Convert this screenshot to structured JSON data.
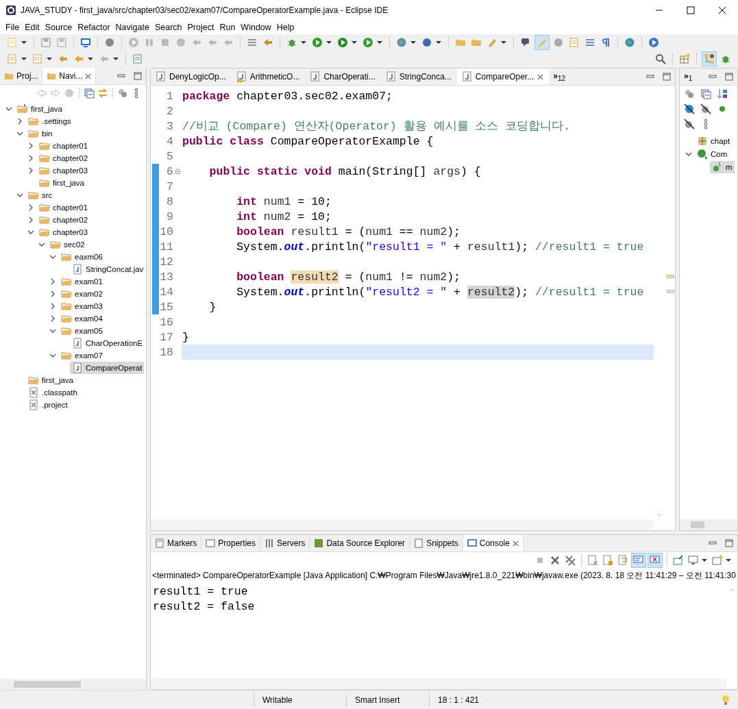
{
  "window": {
    "title": "JAVA_STUDY - first_java/src/chapter03/sec02/exam07/CompareOperatorExample.java - Eclipse IDE"
  },
  "menu": [
    "File",
    "Edit",
    "Source",
    "Refactor",
    "Navigate",
    "Search",
    "Project",
    "Run",
    "Window",
    "Help"
  ],
  "toolbar": {
    "mark_occurrences_on": true,
    "java_perspective_selected": true
  },
  "navigator": {
    "tabs": [
      {
        "label": "Proj...",
        "selected": false
      },
      {
        "label": "Navi...",
        "selected": true
      }
    ],
    "tree": [
      {
        "label": "first_java",
        "kind": "project",
        "expanded": true,
        "selected": false,
        "children": [
          {
            "label": ".settings",
            "kind": "folder",
            "expanded": false,
            "selected": false
          },
          {
            "label": "bin",
            "kind": "folder",
            "expanded": true,
            "selected": false,
            "children": [
              {
                "label": "chapter01",
                "kind": "folder",
                "expanded": false,
                "selected": false
              },
              {
                "label": "chapter02",
                "kind": "folder",
                "expanded": false,
                "selected": false
              },
              {
                "label": "chapter03",
                "kind": "folder",
                "expanded": false,
                "selected": false
              },
              {
                "label": "first_java",
                "kind": "folder",
                "selected": false
              }
            ]
          },
          {
            "label": "src",
            "kind": "folder",
            "expanded": true,
            "selected": false,
            "children": [
              {
                "label": "chapter01",
                "kind": "folder",
                "expanded": false,
                "selected": false
              },
              {
                "label": "chapter02",
                "kind": "folder",
                "expanded": false,
                "selected": false
              },
              {
                "label": "chapter03",
                "kind": "folder",
                "expanded": true,
                "selected": false,
                "children": [
                  {
                    "label": "sec02",
                    "kind": "folder",
                    "expanded": true,
                    "selected": false,
                    "children": [
                      {
                        "label": "eaxm06",
                        "kind": "folder",
                        "expanded": true,
                        "selected": false,
                        "children": [
                          {
                            "label": "StringConcat.jav",
                            "kind": "java-file",
                            "selected": false
                          }
                        ]
                      },
                      {
                        "label": "exam01",
                        "kind": "folder",
                        "expanded": false,
                        "selected": false
                      },
                      {
                        "label": "exam02",
                        "kind": "folder",
                        "expanded": false,
                        "selected": false
                      },
                      {
                        "label": "exam03",
                        "kind": "folder",
                        "expanded": false,
                        "selected": false
                      },
                      {
                        "label": "exam04",
                        "kind": "folder",
                        "expanded": false,
                        "selected": false
                      },
                      {
                        "label": "exam05",
                        "kind": "folder",
                        "expanded": true,
                        "selected": false,
                        "children": [
                          {
                            "label": "CharOperationE",
                            "kind": "java-file",
                            "selected": false
                          }
                        ]
                      },
                      {
                        "label": "exam07",
                        "kind": "folder",
                        "expanded": true,
                        "selected": false,
                        "children": [
                          {
                            "label": "CompareOperat",
                            "kind": "java-file",
                            "selected": true
                          }
                        ]
                      }
                    ]
                  }
                ]
              }
            ]
          },
          {
            "label": "first_java",
            "kind": "folder",
            "selected": false
          },
          {
            "label": ".classpath",
            "kind": "xml-file",
            "selected": false
          },
          {
            "label": ".project",
            "kind": "xml-file",
            "selected": false
          }
        ]
      }
    ]
  },
  "editor": {
    "tabs": [
      {
        "label": "DenyLogicOp...",
        "warning": false,
        "selected": false
      },
      {
        "label": "ArithmeticO...",
        "warning": true,
        "selected": false
      },
      {
        "label": "CharOperati...",
        "warning": false,
        "selected": false
      },
      {
        "label": "StringConca...",
        "warning": false,
        "selected": false
      },
      {
        "label": "CompareOper...",
        "warning": false,
        "selected": true
      }
    ],
    "overflow": {
      "symbol": "»",
      "count": "12"
    },
    "lines": [
      {
        "number": "1",
        "changed": false,
        "current": false,
        "segments": [
          {
            "text": "package",
            "kind": "keyword"
          },
          {
            "text": " chapter03.sec02.exam07;",
            "kind": "plain"
          }
        ]
      },
      {
        "number": "2",
        "changed": false,
        "current": false
      },
      {
        "number": "3",
        "changed": false,
        "current": false,
        "segments": [
          {
            "text": "//비교 (Compare) 연산자(Operator) 활용 예시를 소스 코딩합니다.",
            "kind": "comment"
          }
        ]
      },
      {
        "number": "4",
        "changed": false,
        "current": false,
        "segments": [
          {
            "text": "public class",
            "kind": "keyword"
          },
          {
            "text": " CompareOperatorExample {",
            "kind": "plain"
          }
        ]
      },
      {
        "number": "5",
        "changed": false,
        "current": false
      },
      {
        "number": "6",
        "changed": true,
        "current": false,
        "folded": false,
        "segments": [
          {
            "text": "    public static void",
            "kind": "keyword"
          },
          {
            "text": " main(String[] ",
            "kind": "plain"
          },
          {
            "text": "args",
            "kind": "variable"
          },
          {
            "text": ") {",
            "kind": "plain"
          }
        ]
      },
      {
        "number": "7",
        "changed": true,
        "current": false
      },
      {
        "number": "8",
        "changed": true,
        "current": false,
        "segments": [
          {
            "text": "        int ",
            "kind": "keyword"
          },
          {
            "text": "num1",
            "kind": "variable"
          },
          {
            "text": " = 10;",
            "kind": "plain"
          }
        ]
      },
      {
        "number": "9",
        "changed": true,
        "current": false,
        "segments": [
          {
            "text": "        int ",
            "kind": "keyword"
          },
          {
            "text": "num2",
            "kind": "variable"
          },
          {
            "text": " = 10;",
            "kind": "plain"
          }
        ]
      },
      {
        "number": "10",
        "changed": true,
        "current": false,
        "segments": [
          {
            "text": "        boolean ",
            "kind": "keyword"
          },
          {
            "text": "result1",
            "kind": "variable"
          },
          {
            "text": " = (",
            "kind": "plain"
          },
          {
            "text": "num1",
            "kind": "variable"
          },
          {
            "text": " == ",
            "kind": "plain"
          },
          {
            "text": "num2",
            "kind": "variable"
          },
          {
            "text": ");",
            "kind": "plain"
          }
        ]
      },
      {
        "number": "11",
        "changed": true,
        "current": false,
        "segments": [
          {
            "text": "        System.",
            "kind": "plain"
          },
          {
            "text": "out",
            "kind": "static-field"
          },
          {
            "text": ".println(",
            "kind": "plain"
          },
          {
            "text": "\"result1 = \"",
            "kind": "string"
          },
          {
            "text": " + ",
            "kind": "plain"
          },
          {
            "text": "result1",
            "kind": "variable"
          },
          {
            "text": "); ",
            "kind": "plain"
          },
          {
            "text": "//result1 = true",
            "kind": "comment"
          }
        ]
      },
      {
        "number": "12",
        "changed": true,
        "current": false
      },
      {
        "number": "13",
        "changed": true,
        "current": false,
        "segments": [
          {
            "text": "        boolean ",
            "kind": "keyword"
          },
          {
            "text": "result2",
            "kind": "write-occurrence"
          },
          {
            "text": " = (",
            "kind": "plain"
          },
          {
            "text": "num1",
            "kind": "variable"
          },
          {
            "text": " != ",
            "kind": "plain"
          },
          {
            "text": "num2",
            "kind": "variable"
          },
          {
            "text": ");",
            "kind": "plain"
          }
        ]
      },
      {
        "number": "14",
        "changed": true,
        "current": false,
        "segments": [
          {
            "text": "        System.",
            "kind": "plain"
          },
          {
            "text": "out",
            "kind": "static-field"
          },
          {
            "text": ".println(",
            "kind": "plain"
          },
          {
            "text": "\"result2 = \"",
            "kind": "string"
          },
          {
            "text": " + ",
            "kind": "plain"
          },
          {
            "text": "result2",
            "kind": "read-occurrence"
          },
          {
            "text": "); ",
            "kind": "plain"
          },
          {
            "text": "//result1 = true",
            "kind": "comment"
          }
        ]
      },
      {
        "number": "15",
        "changed": true,
        "current": false,
        "segments": [
          {
            "text": "    }",
            "kind": "plain"
          }
        ]
      },
      {
        "number": "16",
        "changed": false,
        "current": false
      },
      {
        "number": "17",
        "changed": false,
        "current": false,
        "segments": [
          {
            "text": "}",
            "kind": "plain"
          }
        ]
      },
      {
        "number": "18",
        "changed": false,
        "current": true
      }
    ]
  },
  "outline": {
    "overflow": {
      "symbol": "»",
      "count": "1"
    },
    "items": [
      {
        "label": "chapt",
        "kind": "package",
        "selected": false
      },
      {
        "label": "Com",
        "kind": "class",
        "expanded": true,
        "selected": false
      },
      {
        "label": "m",
        "kind": "method",
        "selected": true
      }
    ]
  },
  "console": {
    "tabs": [
      {
        "label": "Markers",
        "kind": "markers",
        "selected": false
      },
      {
        "label": "Properties",
        "kind": "properties",
        "selected": false
      },
      {
        "label": "Servers",
        "kind": "servers",
        "selected": false
      },
      {
        "label": "Data Source Explorer",
        "kind": "datasource",
        "selected": false
      },
      {
        "label": "Snippets",
        "kind": "snippets",
        "selected": false
      },
      {
        "label": "Console",
        "kind": "console",
        "selected": true
      }
    ],
    "show_on_stdout_on": true,
    "show_on_stderr_on": true,
    "header": "<terminated> CompareOperatorExample [Java Application] C:₩Program Files₩Java₩jre1.8.0_221₩bin₩javaw.exe  (2023. 8. 18 오전 11:41:29 – 오전 11:41:30",
    "output": [
      "result1 = true",
      "result2 = false"
    ]
  },
  "status_bar": {
    "mode": "Writable",
    "insert": "Smart Insert",
    "position": "18 : 1 : 421"
  }
}
